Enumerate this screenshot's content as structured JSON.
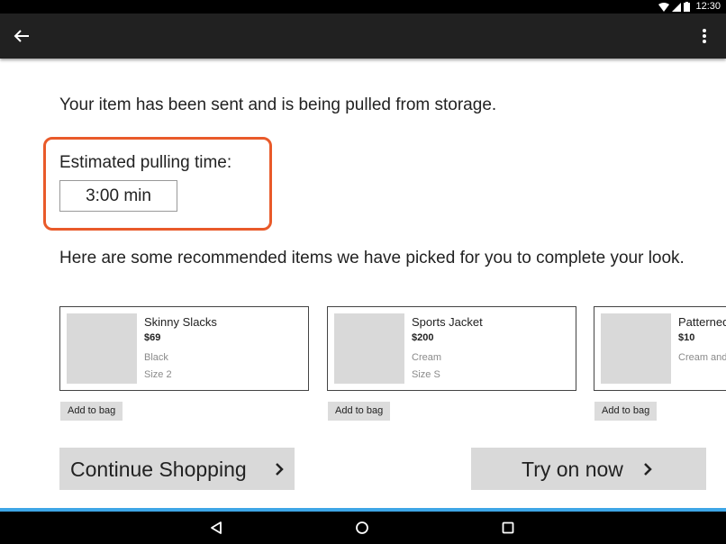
{
  "status_bar": {
    "time": "12:30"
  },
  "app_bar": {
    "back_icon": "arrow-left-icon",
    "menu_icon": "more-vertical-icon"
  },
  "content": {
    "sent_message": "Your item has been sent and is being pulled from storage.",
    "estimate_label": "Estimated pulling time:",
    "estimate_value": "3:00 min",
    "highlight_color": "#e95a2a",
    "recommend_message": "Here are some recommended items we have picked for you to complete your look."
  },
  "recommendations": [
    {
      "name": "Skinny Slacks",
      "price": "$69",
      "color": "Black",
      "size": "Size  2",
      "add_label": "Add to bag"
    },
    {
      "name": "Sports Jacket",
      "price": "$200",
      "color": "Cream",
      "size": "Size  S",
      "add_label": "Add to bag"
    },
    {
      "name": "Patterned",
      "price": "$10",
      "color": "Cream and",
      "size": "",
      "add_label": "Add to bag"
    }
  ],
  "actions": {
    "continue_label": "Continue Shopping",
    "try_on_label": "Try on now"
  },
  "nav_bar": {
    "back_icon": "triangle-back-icon",
    "home_icon": "circle-home-icon",
    "recents_icon": "square-recents-icon"
  }
}
